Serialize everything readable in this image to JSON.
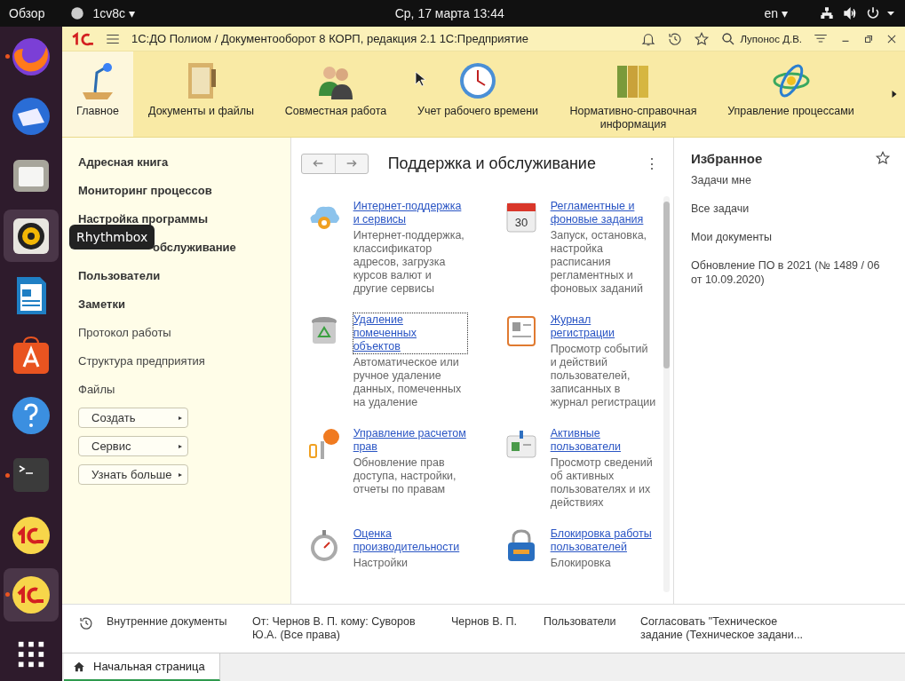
{
  "top_bar": {
    "overview": "Обзор",
    "app_name": "1cv8c ▾",
    "clock": "Ср, 17 марта  13:44",
    "language": "en ▾"
  },
  "dock": {
    "items": [
      {
        "running": true,
        "highlighted": false
      },
      {
        "running": false,
        "highlighted": false
      },
      {
        "running": false,
        "highlighted": false
      },
      {
        "running": false,
        "highlighted": true
      },
      {
        "running": false,
        "highlighted": false
      },
      {
        "running": false,
        "highlighted": false
      },
      {
        "running": false,
        "highlighted": false
      },
      {
        "running": true,
        "highlighted": false
      },
      {
        "running": false,
        "highlighted": false
      },
      {
        "running": true,
        "highlighted": true
      }
    ],
    "tooltip": "Rhythmbox"
  },
  "window": {
    "title": "1С:ДО Полиом / Документооборот 8 КОРП, редакция 2.1 1С:Предприятие",
    "user": "Лупонос Д.В."
  },
  "sections": [
    {
      "label": "Главное",
      "selected": true
    },
    {
      "label": "Документы и файлы",
      "selected": false
    },
    {
      "label": "Совместная работа",
      "selected": false
    },
    {
      "label": "Учет рабочего времени",
      "selected": false
    },
    {
      "label": "Нормативно-справочная информация",
      "selected": false
    },
    {
      "label": "Управление процессами",
      "selected": false
    }
  ],
  "sidebar": {
    "items": [
      {
        "label": "Адресная книга",
        "bold": true
      },
      {
        "label": "Мониторинг процессов",
        "bold": true
      },
      {
        "label": "Настройка программы",
        "bold": true
      },
      {
        "label": "обслуживание",
        "bold": true,
        "partly_hidden": true
      },
      {
        "label": "Пользователи",
        "bold": true
      },
      {
        "label": "Заметки",
        "bold": true
      },
      {
        "label": "Протокол работы",
        "bold": false
      },
      {
        "label": "Структура предприятия",
        "bold": false
      },
      {
        "label": "Файлы",
        "bold": false
      }
    ],
    "buttons": [
      {
        "label": "Создать",
        "arrow": "▸"
      },
      {
        "label": "Сервис",
        "arrow": "▸"
      },
      {
        "label": "Узнать больше",
        "arrow": "▸"
      }
    ]
  },
  "content": {
    "title": "Поддержка и обслуживание",
    "more": "⋮",
    "cards": [
      {
        "link": "Интернет-поддержка и сервисы",
        "focused": false,
        "description": "Интернет-поддержка, классификатор адресов, загрузка курсов валют и другие сервисы"
      },
      {
        "link": "Регламентные и фоновые задания",
        "focused": false,
        "icon_text": "30",
        "description": "Запуск, остановка, настройка расписания регламентных и фоновых заданий"
      },
      {
        "link": "Удаление помеченных объектов",
        "focused": true,
        "description": "Автоматическое или ручное удаление данных, помеченных на удаление"
      },
      {
        "link": "Журнал регистрации",
        "focused": false,
        "description": "Просмотр событий и действий пользователей, записанных в журнал регистрации"
      },
      {
        "link": "Управление расчетом прав",
        "focused": false,
        "description": "Обновление прав доступа, настройки, отчеты по правам"
      },
      {
        "link": "Активные пользователи",
        "focused": false,
        "description": "Просмотр сведений об активных пользователях и их действиях"
      },
      {
        "link": "Оценка производительности",
        "focused": false,
        "description": "Настройки"
      },
      {
        "link": "Блокировка работы пользователей",
        "focused": false,
        "description": "Блокировка"
      }
    ]
  },
  "favorites": {
    "title": "Избранное",
    "items": [
      "Задачи мне",
      "Все задачи",
      "Мои документы",
      "Обновление ПО в 2021 (№ 1489 / 06 от 10.09.2020)"
    ]
  },
  "history_bar": {
    "columns": [
      "Внутренние документы",
      "От: Чернов В.  П. кому: Суворов Ю.А. (Все права)",
      "Чернов В.  П.",
      "Пользователи",
      "Согласовать \"Техническое задание (Техническое задани..."
    ]
  },
  "tabs": [
    {
      "label": "Начальная страница",
      "selected": true
    }
  ]
}
